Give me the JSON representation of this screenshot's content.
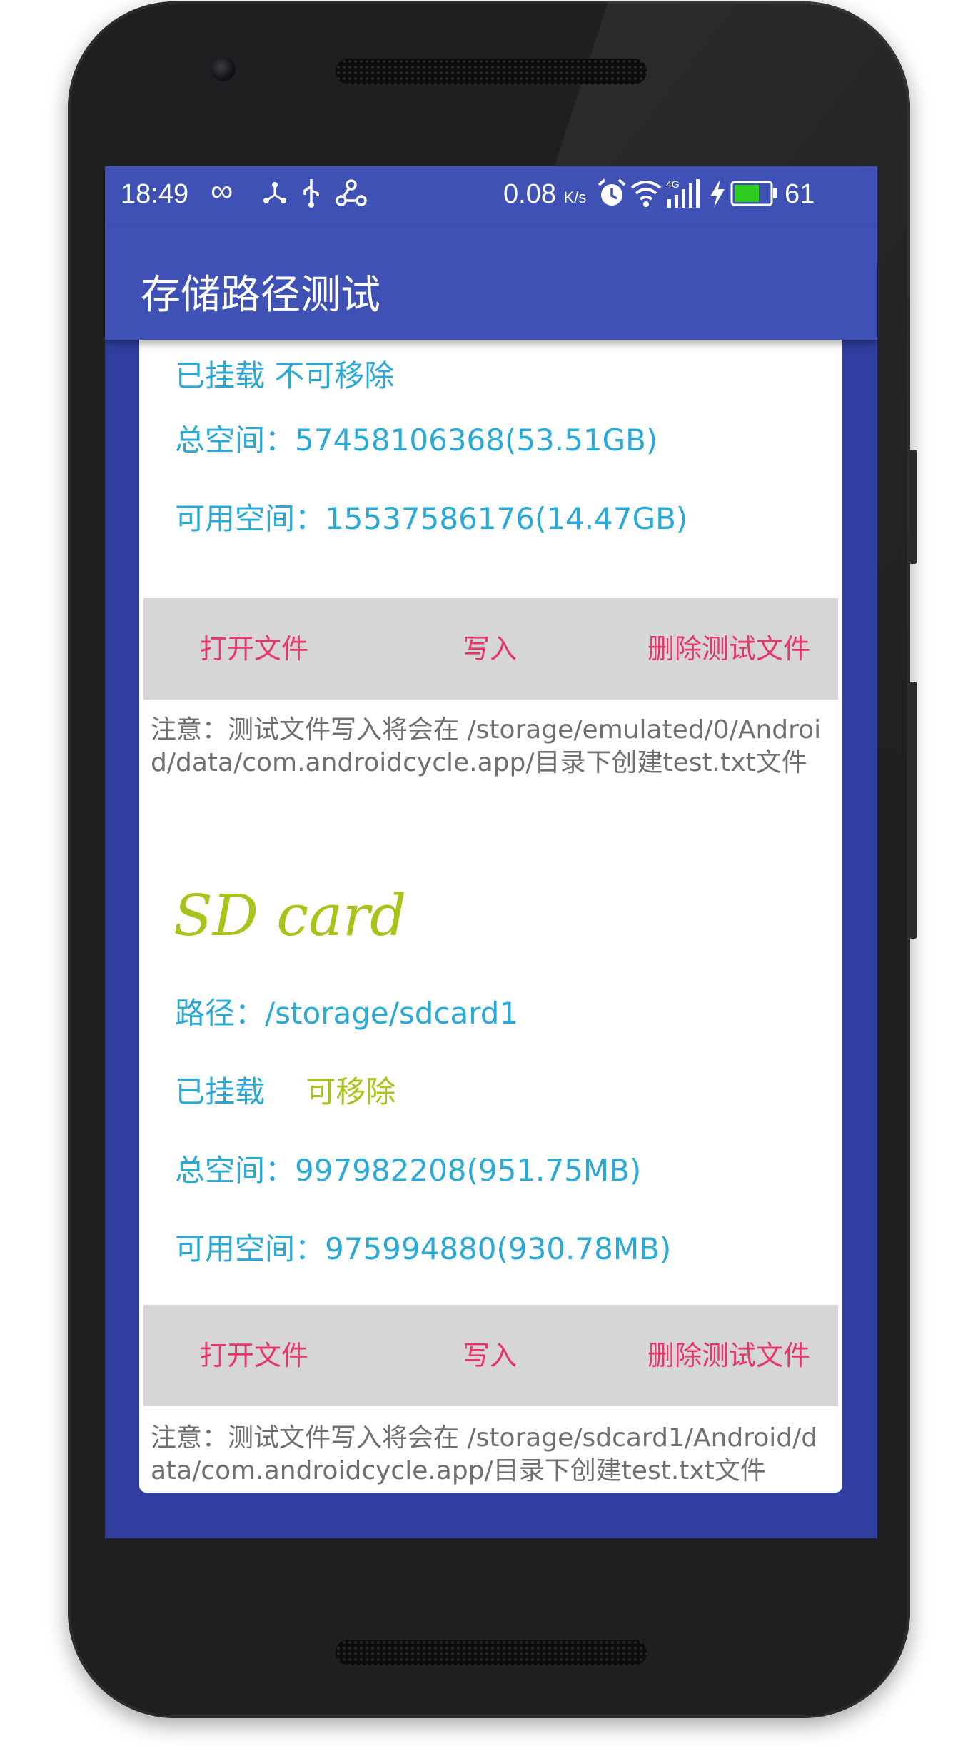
{
  "statusbar": {
    "time": "18:49",
    "speed": "0.08",
    "speed_unit": "K/s",
    "network": "4G",
    "battery": "61",
    "icons": [
      "infinity-icon",
      "usb-tether-icon",
      "usb-icon",
      "share-icon",
      "alarm-icon",
      "wifi-icon",
      "signal-icon",
      "charging-icon",
      "battery-icon"
    ]
  },
  "appbar": {
    "title": "存储路径测试"
  },
  "internal_card": {
    "partial_top": "已挂载 不可移除",
    "total_label": "总空间：",
    "total_value": "57458106368(53.51GB)",
    "free_label": "可用空间：",
    "free_value": "15537586176(14.47GB)",
    "buttons": {
      "open": "打开文件",
      "write": "写入",
      "delete": "删除测试文件"
    },
    "note": "注意：测试文件写入将会在 /storage/emulated/0/Android/data/com.androidcycle.app/目录下创建test.txt文件"
  },
  "sd_card": {
    "title": "SD card",
    "path_label": "路径：",
    "path_value": "/storage/sdcard1",
    "mounted": "已挂载",
    "removable": "可移除",
    "total_label": "总空间：",
    "total_value": "997982208(951.75MB)",
    "free_label": "可用空间：",
    "free_value": "975994880(930.78MB)",
    "buttons": {
      "open": "打开文件",
      "write": "写入",
      "delete": "删除测试文件"
    },
    "note": "注意：测试文件写入将会在 /storage/sdcard1/Android/data/com.androidcycle.app/目录下创建test.txt文件"
  },
  "colors": {
    "primary": "#3f51b5",
    "primary_dark": "#303f9f",
    "info_blue": "#29a9d8",
    "accent_green": "#a8c41a",
    "action_pink": "#e8356a",
    "button_bar": "#d6d6d6"
  }
}
